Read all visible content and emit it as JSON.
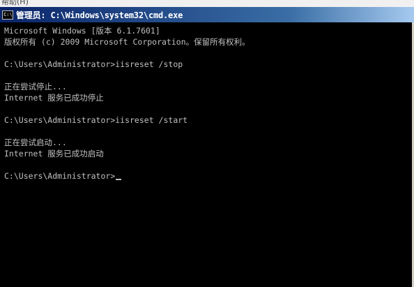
{
  "background_window": {
    "partial_text": "帮助(H)"
  },
  "window": {
    "title": "管理员: C:\\Windows\\system32\\cmd.exe",
    "icon": "cmd-icon",
    "colors": {
      "background": "#000000",
      "text": "#c0c0c0",
      "titlebar_start": "#0a246a",
      "titlebar_end": "#a6caf0"
    }
  },
  "console": {
    "lines": [
      "Microsoft Windows [版本 6.1.7601]",
      "版权所有 (c) 2009 Microsoft Corporation。保留所有权利。",
      "",
      "C:\\Users\\Administrator>iisreset /stop",
      "",
      "正在尝试停止...",
      "Internet 服务已成功停止",
      "",
      "C:\\Users\\Administrator>iisreset /start",
      "",
      "正在尝试启动...",
      "Internet 服务已成功启动",
      "",
      "C:\\Users\\Administrator>"
    ]
  }
}
